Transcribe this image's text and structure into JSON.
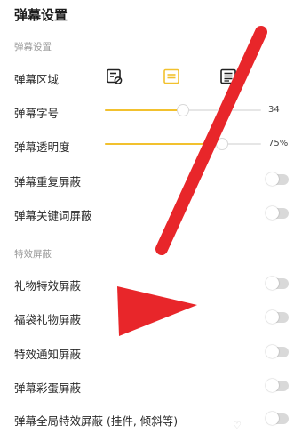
{
  "header": {
    "title": "弹幕设置"
  },
  "sections": {
    "danmaku": "弹幕设置",
    "effects": "特效屏蔽"
  },
  "area": {
    "label": "弹幕区域",
    "options": [
      "top-area-icon",
      "standard-area-icon",
      "full-area-icon"
    ],
    "selected": 1
  },
  "font_size": {
    "label": "弹幕字号",
    "value": "34",
    "level": 0.5
  },
  "opacity": {
    "label": "弹幕透明度",
    "value": "75%",
    "level": 0.75
  },
  "toggles": {
    "repeat": "弹幕重复屏蔽",
    "keyword": "弹幕关键词屏蔽",
    "gift": "礼物特效屏蔽",
    "lucky_bag": "福袋礼物屏蔽",
    "notice": "特效通知屏蔽",
    "egg": "弹幕彩蛋屏蔽",
    "global": "弹幕全局特效屏蔽 (挂件, 倾斜等)"
  },
  "colors": {
    "accent": "#f2c12e",
    "annotation_arrow": "#e8262a",
    "toggle_off": "#d9d9d9"
  }
}
